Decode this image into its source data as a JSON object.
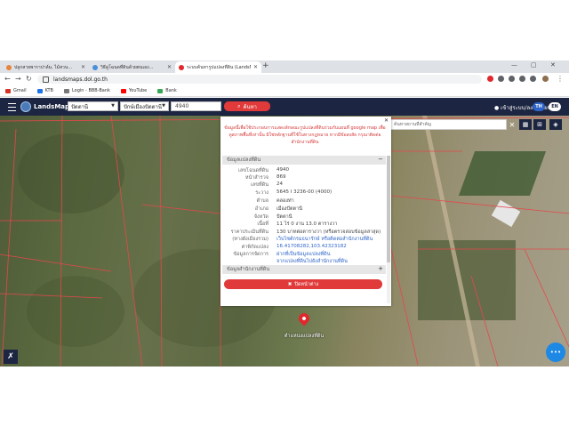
{
  "browser": {
    "tabs": [
      {
        "title": "ปลูกสายพาราปาล์ม, ไม้สวน...",
        "color": "#e8833a",
        "active": false
      },
      {
        "title": "วิธีดูโฉนดที่ดินด้วยตนเอง...",
        "color": "#4a90d9",
        "active": false
      },
      {
        "title": "ระบบค้นหารูปแปลงที่ดิน (LandsMaps)...",
        "color": "#e0282d",
        "active": true
      }
    ],
    "url": "landsmaps.dol.go.th",
    "bookmarks": [
      {
        "label": "Gmail",
        "color": "#d93025"
      },
      {
        "label": "KTB",
        "color": "#1a73e8"
      },
      {
        "label": "Login - BBB-Bank",
        "color": "#777777"
      },
      {
        "label": "YouTube",
        "color": "#ff0000"
      },
      {
        "label": "Bank",
        "color": "#34a853"
      }
    ]
  },
  "app": {
    "brand": "LandsMaps",
    "province": "ปัตตานี",
    "district": "ปักษ์เมืองปัตตานี",
    "parcel_input": "4940",
    "search_label": "ค้นหา",
    "login_label": "เข้าสู่ระบบ/ลงทะเบียน",
    "lang_th": "TH",
    "lang_en": "EN",
    "map_search_placeholder": "ค้นหาสถานที่สำคัญ"
  },
  "popup": {
    "notice": "ข้อมูลนี้เพื่อใช้ประกอบการแสดงลักษณะรูปแปลงที่ดินร่วมกับแผนที่ google map เพื่อดูสภาพพื้นที่เท่านั้น มิใช่หลักฐานที่ใช้ในทางกฎหมาย หากมีข้อสงสัย กรุณาติดต่อสำนักงานที่ดิน",
    "section1": "ข้อมูลแปลงที่ดิน",
    "section2": "ข้อมูลสำนักงานที่ดิน",
    "fields": [
      {
        "label": "เลขโฉนดที่ดิน",
        "value": "4940",
        "link": false
      },
      {
        "label": "หน้าสำรวจ",
        "value": "869",
        "link": false
      },
      {
        "label": "เลขที่ดิน",
        "value": "24",
        "link": false
      },
      {
        "label": "ระวาง",
        "value": "5645 I 3236-00 (4000)",
        "link": false
      },
      {
        "label": "ตำบล",
        "value": "คลองท่า",
        "link": false
      },
      {
        "label": "อำเภอ",
        "value": "เมืองปัตตานี",
        "link": false
      },
      {
        "label": "จังหวัด",
        "value": "ปัตตานี",
        "link": false
      },
      {
        "label": "เนื้อที่",
        "value": "11 ไร่ 0 งาน 13.0 ตารางวา",
        "link": false
      },
      {
        "label": "ราคาประเมินที่ดิน",
        "value": "130 บาทต่อตารางวา (หรือตรวจสอบข้อมูลล่าสุด)",
        "link": false
      },
      {
        "label": "(ทางผังเมืองรวม)",
        "value": "เว็บไซต์กรมธนารักษ์ หรือติดต่อสำนักงานที่ดิน",
        "link": true
      },
      {
        "label": "ค่าพิกัดแปลง",
        "value": "16.41708282,103.42323182",
        "link": true
      },
      {
        "label": "ข้อมูลการจัดการ",
        "value": "ฝากที่เป็นข้อมูลแปลงที่ดิน",
        "link": true
      },
      {
        "label": "",
        "value": "จากแปลงที่ดินไปยังสำนักงานที่ดิน",
        "link": true
      }
    ],
    "close_label": "ปิดหน้าต่าง"
  },
  "pin_label": "ตำแหน่งแปลงที่ดิน",
  "chat_label": "•••"
}
